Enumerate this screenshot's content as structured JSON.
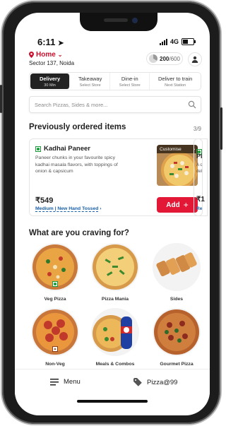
{
  "status": {
    "time": "6:11",
    "network": "4G"
  },
  "location": {
    "label": "Home",
    "address": "Sector 137, Noida"
  },
  "points": {
    "earned": "200",
    "total": "/600"
  },
  "tabs": [
    {
      "label": "Delivery",
      "sub": "30 Min"
    },
    {
      "label": "Takeaway",
      "sub": "Select Store"
    },
    {
      "label": "Dine-in",
      "sub": "Select Store"
    },
    {
      "label": "Deliver to train",
      "sub": "Next Station"
    }
  ],
  "search": {
    "placeholder": "Search Pizzas, Sides & more..."
  },
  "previous": {
    "title": "Previously ordered items",
    "count": "3/9",
    "item": {
      "name": "Kadhai Paneer",
      "description": "Paneer chunks in your favourite spicy kadhai masala flavors, with toppings of onion & capsicum",
      "customise": "Customise",
      "price": "₹549",
      "size": "Medium | New Hand Tossed",
      "add": "Add"
    },
    "next_item": {
      "name": "Pi",
      "description": "A c del",
      "price": "₹1",
      "size": "Re"
    }
  },
  "crave": {
    "title": "What are you craving for?",
    "categories": [
      {
        "label": "Veg Pizza"
      },
      {
        "label": "Pizza Mania"
      },
      {
        "label": "Sides"
      },
      {
        "label": "Non-Veg"
      },
      {
        "label": "Meals & Combos"
      },
      {
        "label": "Gourmet Pizza"
      }
    ]
  },
  "bottom_nav": {
    "menu": "Menu",
    "deal": "Pizza@99"
  },
  "colors": {
    "brand_red": "#e31837",
    "dark": "#222222",
    "link_blue": "#1a5fa8",
    "veg_green": "#1a9c3b"
  }
}
